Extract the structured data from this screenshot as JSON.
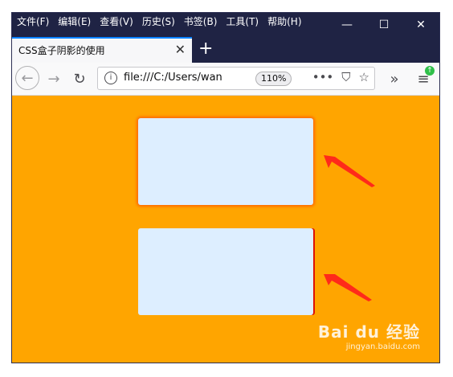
{
  "menu": [
    "文件(F)",
    "编辑(E)",
    "查看(V)",
    "历史(S)",
    "书签(B)",
    "工具(T)",
    "帮助(H)"
  ],
  "window_controls": {
    "minimize": "—",
    "maximize": "☐",
    "close": "✕"
  },
  "tab": {
    "title": "CSS盒子阴影的使用",
    "close": "✕"
  },
  "newtab": "+",
  "nav": {
    "back": "←",
    "forward": "→",
    "reload": "↻"
  },
  "urlbar": {
    "info": "i",
    "url": "file:///C:/Users/wan",
    "zoom": "110%",
    "more": "•••",
    "pocket": "⛉",
    "bookmark": "☆"
  },
  "toolbar": {
    "overflow": "»",
    "menu": "≡"
  },
  "page": {
    "background": "#ffa500",
    "box_color": "#ddeeff",
    "shadow1": "#ff6a00",
    "shadow2": "#dd1100"
  },
  "watermark": {
    "main": "Bai du 经验",
    "sub": "jingyan.baidu.com"
  }
}
